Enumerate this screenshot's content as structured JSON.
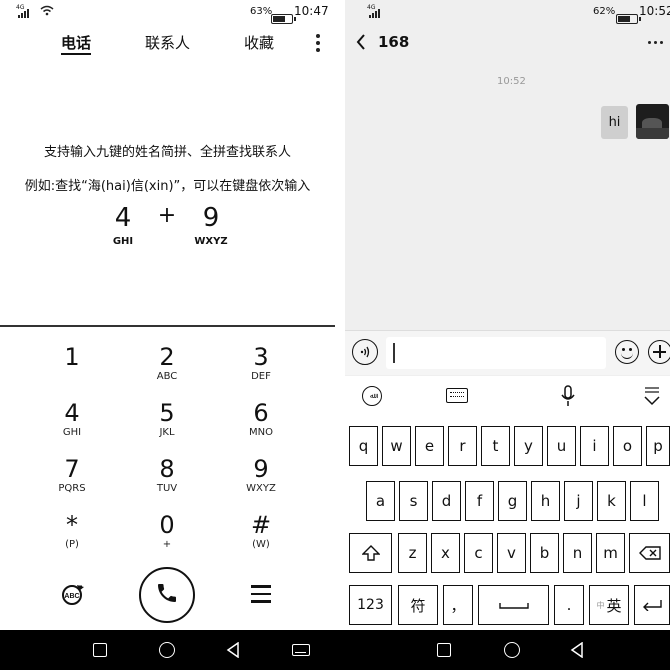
{
  "left": {
    "status": {
      "network": "4G",
      "battery": "63%",
      "time": "10:47"
    },
    "tabs": [
      "电话",
      "联系人",
      "收藏"
    ],
    "hint_line1": "支持输入九键的姓名简拼、全拼查找联系人",
    "hint_line2": "例如:查找“海(hai)信(xin)”，可以在键盘依次输入",
    "example": {
      "d1": "4",
      "l1": "GHI",
      "plus": "+",
      "d2": "9",
      "l2": "WXYZ"
    },
    "keys": [
      {
        "d": "1",
        "l": ""
      },
      {
        "d": "2",
        "l": "ABC"
      },
      {
        "d": "3",
        "l": "DEF"
      },
      {
        "d": "4",
        "l": "GHI"
      },
      {
        "d": "5",
        "l": "JKL"
      },
      {
        "d": "6",
        "l": "MNO"
      },
      {
        "d": "7",
        "l": "PQRS"
      },
      {
        "d": "8",
        "l": "TUV"
      },
      {
        "d": "9",
        "l": "WXYZ"
      },
      {
        "d": "*",
        "l": "(P)"
      },
      {
        "d": "0",
        "l": "+"
      },
      {
        "d": "#",
        "l": "(W)"
      }
    ],
    "abc_icon_label": "ABC"
  },
  "right": {
    "status": {
      "network": "4G",
      "battery": "62%",
      "time": "10:52"
    },
    "chat_title": "168",
    "timestamp": "10:52",
    "message": "hi",
    "keyboard": {
      "row1": [
        "q",
        "w",
        "e",
        "r",
        "t",
        "y",
        "u",
        "i",
        "o",
        "p"
      ],
      "row2": [
        "a",
        "s",
        "d",
        "f",
        "g",
        "h",
        "j",
        "k",
        "l"
      ],
      "row3": [
        "z",
        "x",
        "c",
        "v",
        "b",
        "n",
        "m"
      ],
      "num_key": "123",
      "sym_key": "符",
      "comma_key": "，",
      "dot_key": ".",
      "lang_key": "英",
      "lang_sub": "中"
    }
  }
}
